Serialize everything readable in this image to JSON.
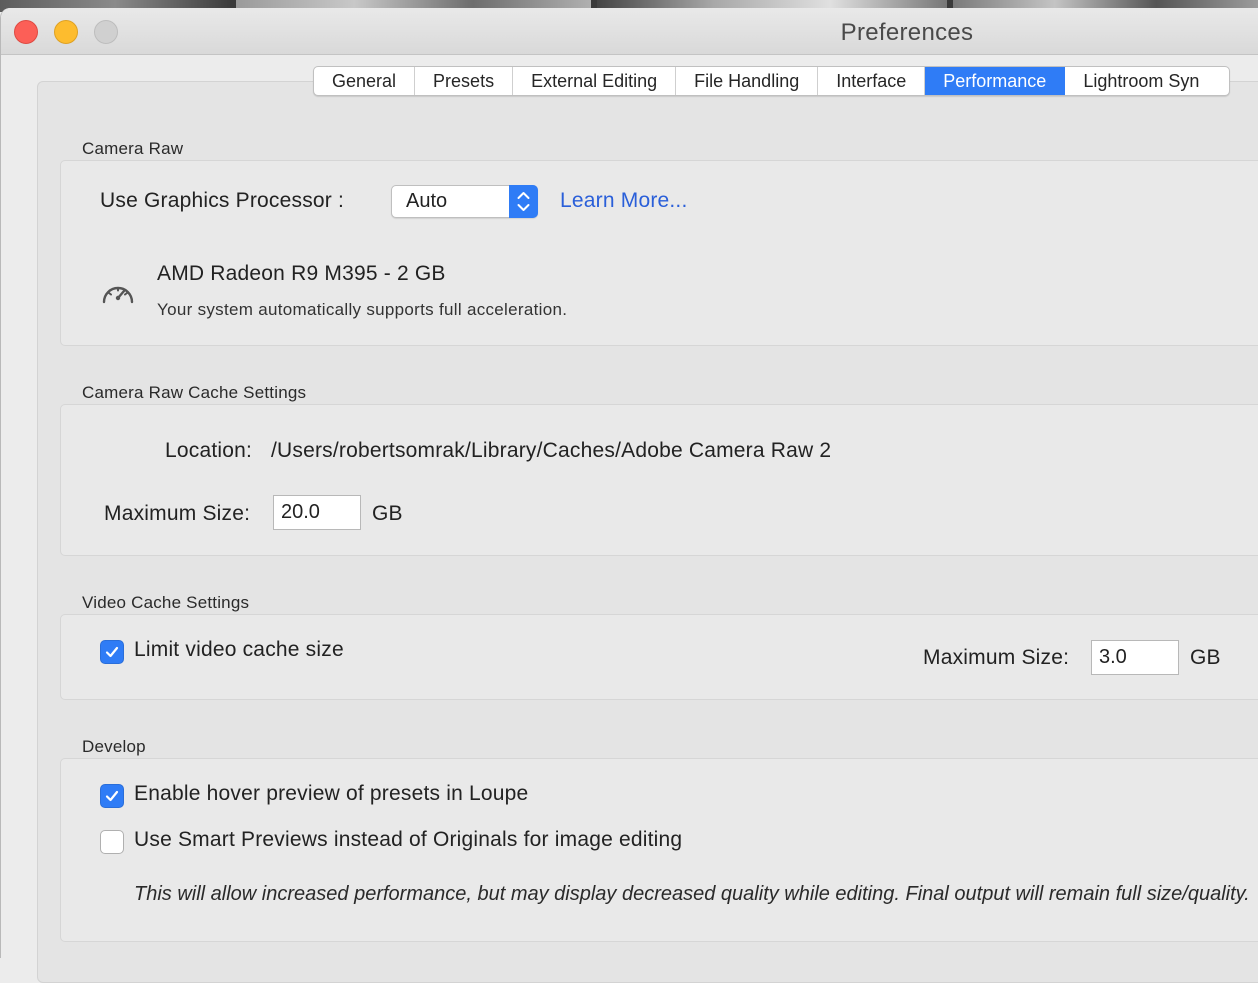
{
  "window": {
    "title": "Preferences"
  },
  "tabs": [
    {
      "label": "General",
      "active": false
    },
    {
      "label": "Presets",
      "active": false
    },
    {
      "label": "External Editing",
      "active": false
    },
    {
      "label": "File Handling",
      "active": false
    },
    {
      "label": "Interface",
      "active": false
    },
    {
      "label": "Performance",
      "active": true
    },
    {
      "label": "Lightroom Syn",
      "active": false
    }
  ],
  "camera_raw": {
    "section_label": "Camera Raw",
    "gpu_label": "Use Graphics Processor :",
    "gpu_value": "Auto",
    "learn_more": "Learn More...",
    "gpu_name": "AMD Radeon R9 M395 - 2 GB",
    "gpu_status": "Your system automatically supports full acceleration."
  },
  "cache": {
    "section_label": "Camera Raw Cache Settings",
    "location_label": "Location:",
    "location_value": "/Users/robertsomrak/Library/Caches/Adobe Camera Raw 2",
    "max_size_label": "Maximum Size:",
    "max_size_value": "20.0",
    "unit": "GB"
  },
  "video_cache": {
    "section_label": "Video Cache Settings",
    "limit_label": "Limit video cache size",
    "limit_checked": true,
    "max_size_label": "Maximum Size:",
    "max_size_value": "3.0",
    "unit": "GB"
  },
  "develop": {
    "section_label": "Develop",
    "hover_preview_label": "Enable hover preview of presets in Loupe",
    "hover_preview_checked": true,
    "smart_previews_label": "Use Smart Previews instead of Originals for image editing",
    "smart_previews_checked": false,
    "note": "This will allow increased performance, but may display decreased quality while editing. Final output will remain full size/quality."
  },
  "colors": {
    "accent": "#2f7cf6",
    "link": "#2a5fd9"
  }
}
